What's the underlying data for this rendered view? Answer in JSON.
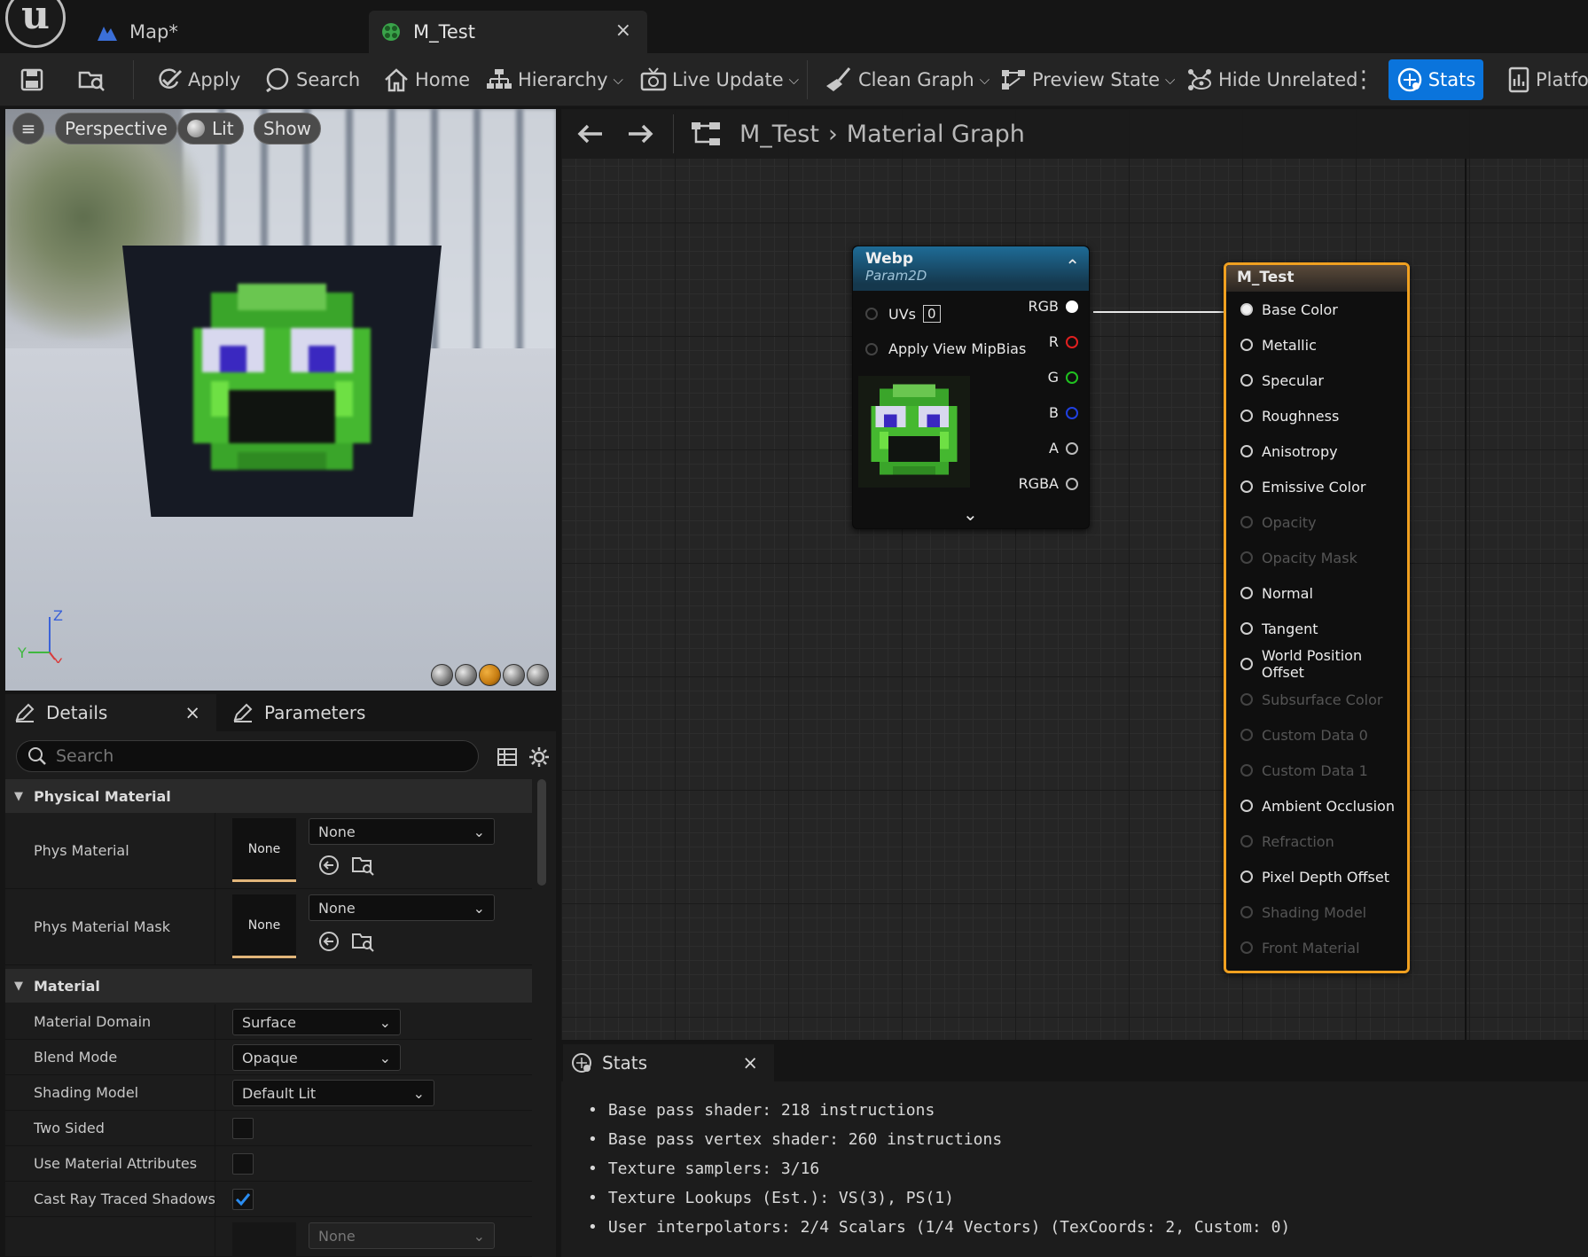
{
  "title_bar": {
    "tabs": [
      {
        "label": "Map*"
      },
      {
        "label": "M_Test",
        "close": "×"
      }
    ]
  },
  "toolbar": {
    "apply": "Apply",
    "search": "Search",
    "home": "Home",
    "hierarchy": "Hierarchy",
    "live_update": "Live Update",
    "clean_graph": "Clean Graph",
    "preview_state": "Preview State",
    "hide_unrelated": "Hide Unrelated",
    "stats": "Stats",
    "platforms": "Platfor"
  },
  "viewport": {
    "menu_pill": "≡",
    "perspective": "Perspective",
    "lit": "Lit",
    "show": "Show",
    "axis": {
      "z": "Z",
      "y": "Y",
      "x": "X"
    }
  },
  "details": {
    "tabs": {
      "details": "Details",
      "parameters": "Parameters",
      "close": "×"
    },
    "search_placeholder": "Search",
    "categories": {
      "physical_material": "Physical Material",
      "material": "Material"
    },
    "rows": {
      "phys_material": {
        "label": "Phys Material",
        "thumb": "None",
        "value": "None"
      },
      "phys_material_mask": {
        "label": "Phys Material Mask",
        "thumb": "None",
        "value": "None"
      },
      "material_domain": {
        "label": "Material Domain",
        "value": "Surface"
      },
      "blend_mode": {
        "label": "Blend Mode",
        "value": "Opaque"
      },
      "shading_model": {
        "label": "Shading Model",
        "value": "Default Lit"
      },
      "two_sided": {
        "label": "Two Sided",
        "checked": false
      },
      "use_material_attributes": {
        "label": "Use Material Attributes",
        "checked": false
      },
      "cast_ray_traced_shadows": {
        "label": "Cast Ray Traced Shadows",
        "checked": true
      },
      "subsurface_profile": {
        "value": "None"
      }
    }
  },
  "graph": {
    "breadcrumb": {
      "root": "M_Test",
      "current": "Material Graph"
    },
    "webp_node": {
      "title": "Webp",
      "subtitle": "Param2D",
      "inputs": {
        "uvs": "UVs",
        "uvs_value": "0",
        "mipbias": "Apply View MipBias"
      },
      "outputs": [
        {
          "label": "RGB",
          "color": "#ffffff"
        },
        {
          "label": "R",
          "color": "#e02020"
        },
        {
          "label": "G",
          "color": "#20c020"
        },
        {
          "label": "B",
          "color": "#2040e0"
        },
        {
          "label": "A",
          "color": "#bbbbbb"
        },
        {
          "label": "RGBA",
          "color": "#bbbbbb"
        }
      ]
    },
    "result_node": {
      "title": "M_Test",
      "pins": [
        {
          "label": "Base Color",
          "enabled": true
        },
        {
          "label": "Metallic",
          "enabled": true
        },
        {
          "label": "Specular",
          "enabled": true
        },
        {
          "label": "Roughness",
          "enabled": true
        },
        {
          "label": "Anisotropy",
          "enabled": true
        },
        {
          "label": "Emissive Color",
          "enabled": true
        },
        {
          "label": "Opacity",
          "enabled": false
        },
        {
          "label": "Opacity Mask",
          "enabled": false
        },
        {
          "label": "Normal",
          "enabled": true
        },
        {
          "label": "Tangent",
          "enabled": true
        },
        {
          "label": "World Position Offset",
          "enabled": true
        },
        {
          "label": "Subsurface Color",
          "enabled": false
        },
        {
          "label": "Custom Data 0",
          "enabled": false
        },
        {
          "label": "Custom Data 1",
          "enabled": false
        },
        {
          "label": "Ambient Occlusion",
          "enabled": true
        },
        {
          "label": "Refraction",
          "enabled": false
        },
        {
          "label": "Pixel Depth Offset",
          "enabled": true
        },
        {
          "label": "Shading Model",
          "enabled": false
        },
        {
          "label": "Front Material",
          "enabled": false
        }
      ]
    }
  },
  "stats_panel": {
    "tab": "Stats",
    "close": "×",
    "lines": [
      "Base pass shader: 218 instructions",
      "Base pass vertex shader: 260 instructions",
      "Texture samplers: 3/16",
      "Texture Lookups (Est.): VS(3), PS(1)",
      "User interpolators: 2/4 Scalars (1/4 Vectors) (TexCoords: 2, Custom: 0)"
    ]
  },
  "colors": {
    "accent": "#0a74dc",
    "node_selected": "#f0a020"
  }
}
